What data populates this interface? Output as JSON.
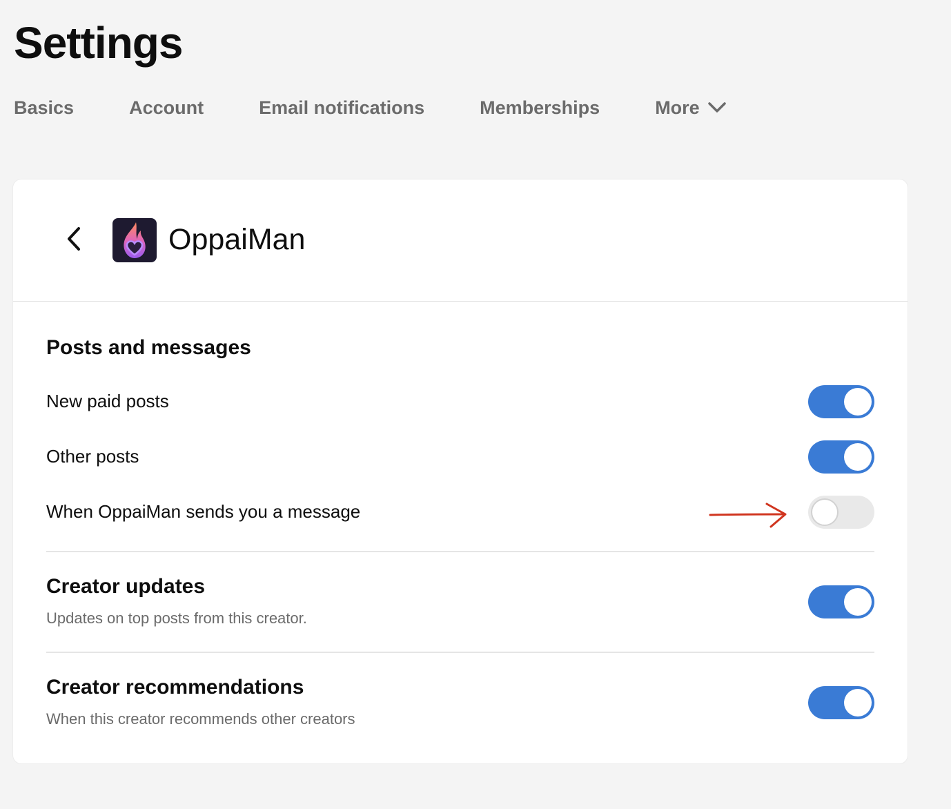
{
  "page": {
    "title": "Settings"
  },
  "tabs": [
    {
      "label": "Basics"
    },
    {
      "label": "Account"
    },
    {
      "label": "Email notifications"
    },
    {
      "label": "Memberships"
    },
    {
      "label": "More",
      "icon": "chevron-down-icon"
    }
  ],
  "creator": {
    "name": "OppaiMan",
    "avatar_icon": "flame-heart-logo"
  },
  "posts_and_messages": {
    "heading": "Posts and messages",
    "items": [
      {
        "label": "New paid posts",
        "enabled": true
      },
      {
        "label": "Other posts",
        "enabled": true
      },
      {
        "label": "When OppaiMan sends you a message",
        "enabled": false
      }
    ]
  },
  "creator_updates": {
    "heading": "Creator updates",
    "description": "Updates on top posts from this creator.",
    "enabled": true
  },
  "creator_recommendations": {
    "heading": "Creator recommendations",
    "description": "When this creator recommends other creators",
    "enabled": true
  },
  "colors": {
    "toggle_on": "#3a7bd5",
    "toggle_off": "#e9e9e9",
    "annotation_arrow": "#d0351f",
    "page_background": "#f4f4f4"
  }
}
